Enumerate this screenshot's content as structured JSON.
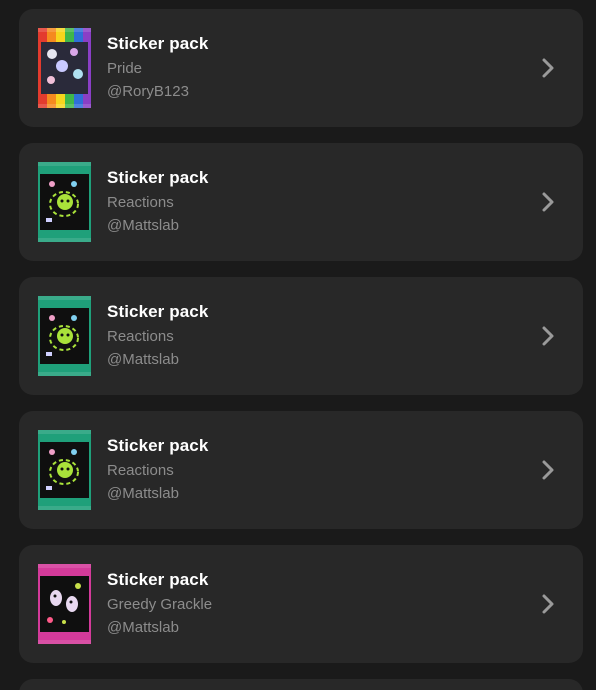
{
  "items": [
    {
      "title": "Sticker pack",
      "subtitle": "Pride",
      "author": "@RoryB123",
      "pack_icon": "pride-pack-icon",
      "pack_colors": [
        "#e33b2e",
        "#f58a1f",
        "#f7d51d",
        "#3fb64a",
        "#2f6fd8",
        "#8a3fc6"
      ]
    },
    {
      "title": "Sticker pack",
      "subtitle": "Reactions",
      "author": "@Mattslab",
      "pack_icon": "reactions-pack-icon",
      "pack_colors": [
        "#1fa07a",
        "#0f0f0f",
        "#a9e23a"
      ]
    },
    {
      "title": "Sticker pack",
      "subtitle": "Reactions",
      "author": "@Mattslab",
      "pack_icon": "reactions-pack-icon",
      "pack_colors": [
        "#1fa07a",
        "#0f0f0f",
        "#a9e23a"
      ]
    },
    {
      "title": "Sticker pack",
      "subtitle": "Reactions",
      "author": "@Mattslab",
      "pack_icon": "reactions-pack-icon",
      "pack_colors": [
        "#1fa07a",
        "#0f0f0f",
        "#a9e23a"
      ]
    },
    {
      "title": "Sticker pack",
      "subtitle": "Greedy Grackle",
      "author": "@Mattslab",
      "pack_icon": "greedy-grackle-pack-icon",
      "pack_colors": [
        "#d43a9a",
        "#0f0f0f",
        "#c8e04a"
      ]
    }
  ],
  "colors": {
    "background": "#1a1a1a",
    "card": "#282828",
    "title": "#ffffff",
    "secondary_text": "#8c8c8c",
    "chevron": "#9a9a9a"
  }
}
